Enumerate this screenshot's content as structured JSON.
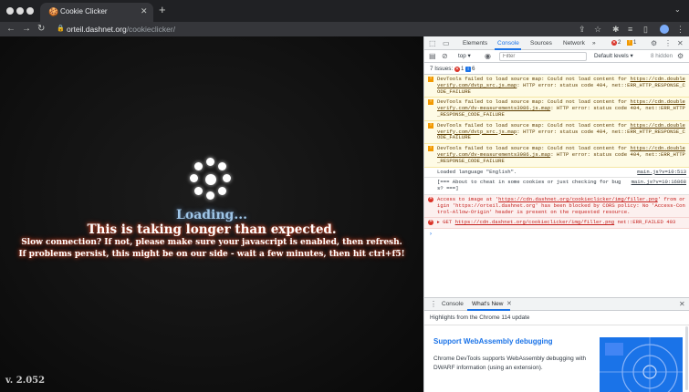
{
  "browser": {
    "tab_title": "Cookie Clicker",
    "favicon": "🍪",
    "url_host": "orteil.dashnet.org",
    "url_path": "/cookieclicker/"
  },
  "page": {
    "loading_text": "Loading...",
    "headline": "This is taking longer than expected.",
    "line2": "Slow connection? If not, please make sure your javascript is enabled, then refresh.",
    "line3": "If problems persist, this might be on our side - wait a few minutes, then hit ctrl+f5!",
    "version": "v. 2.052"
  },
  "devtools": {
    "tabs": [
      "Elements",
      "Console",
      "Sources",
      "Network"
    ],
    "active_tab": "Console",
    "more": "»",
    "error_count": "2",
    "warning_count": "1",
    "context": "top",
    "filter_placeholder": "Filter",
    "levels_label": "Default levels",
    "hidden_label": "8 hidden",
    "issues_label": "7 Issues:",
    "issues_errors": "1",
    "issues_info": "6",
    "messages": [
      {
        "level": "warn",
        "pre": "DevTools failed to load source map: Could not load content for ",
        "link": "https://cdn.doubleverify.com/dvtp_src.js.map",
        "post": ": HTTP error: status code 404, net::ERR_HTTP_RESPONSE_CODE_FAILURE"
      },
      {
        "level": "warn",
        "pre": "DevTools failed to load source map: Could not load content for ",
        "link": "https://cdn.doubleverify.com/dv-measurements3986.js.map",
        "post": ": HTTP error: status code 404, net::ERR_HTTP_RESPONSE_CODE_FAILURE"
      },
      {
        "level": "warn",
        "pre": "DevTools failed to load source map: Could not load content for ",
        "link": "https://cdn.doubleverify.com/dvtp_src.js.map",
        "post": ": HTTP error: status code 404, net::ERR_HTTP_RESPONSE_CODE_FAILURE"
      },
      {
        "level": "warn",
        "pre": "DevTools failed to load source map: Could not load content for ",
        "link": "https://cdn.doubleverify.com/dv-measurements3986.js.map",
        "post": ": HTTP error: status code 404, net::ERR_HTTP_RESPONSE_CODE_FAILURE"
      },
      {
        "level": "info",
        "text": "Loaded language \"English\".",
        "source": "main.js?v=10:513"
      },
      {
        "level": "info",
        "text": "[=== About to cheat in some cookies or just checking for bugs? ===]",
        "source": "main.js?v=10:16868"
      },
      {
        "level": "err",
        "pre": "Access to image at '",
        "link": "https://cdn.dashnet.org/cookieclicker/img/filler.png",
        "post": "' from origin 'https://orteil.dashnet.org' has been blocked by CORS policy: No 'Access-Control-Allow-Origin' header is present on the requested resource."
      },
      {
        "level": "err",
        "pre": "▸ GET ",
        "link": "https://cdn.dashnet.org/cookieclicker/img/filler.png",
        "post": " net::ERR_FAILED 403"
      }
    ],
    "prompt": "›",
    "drawer_tabs": [
      "Console",
      "What's New"
    ],
    "highlights": "Highlights from the Chrome 114 update",
    "whats_new_title": "Support WebAssembly debugging",
    "whats_new_desc": "Chrome DevTools supports WebAssembly debugging with DWARF information (using an extension)."
  }
}
